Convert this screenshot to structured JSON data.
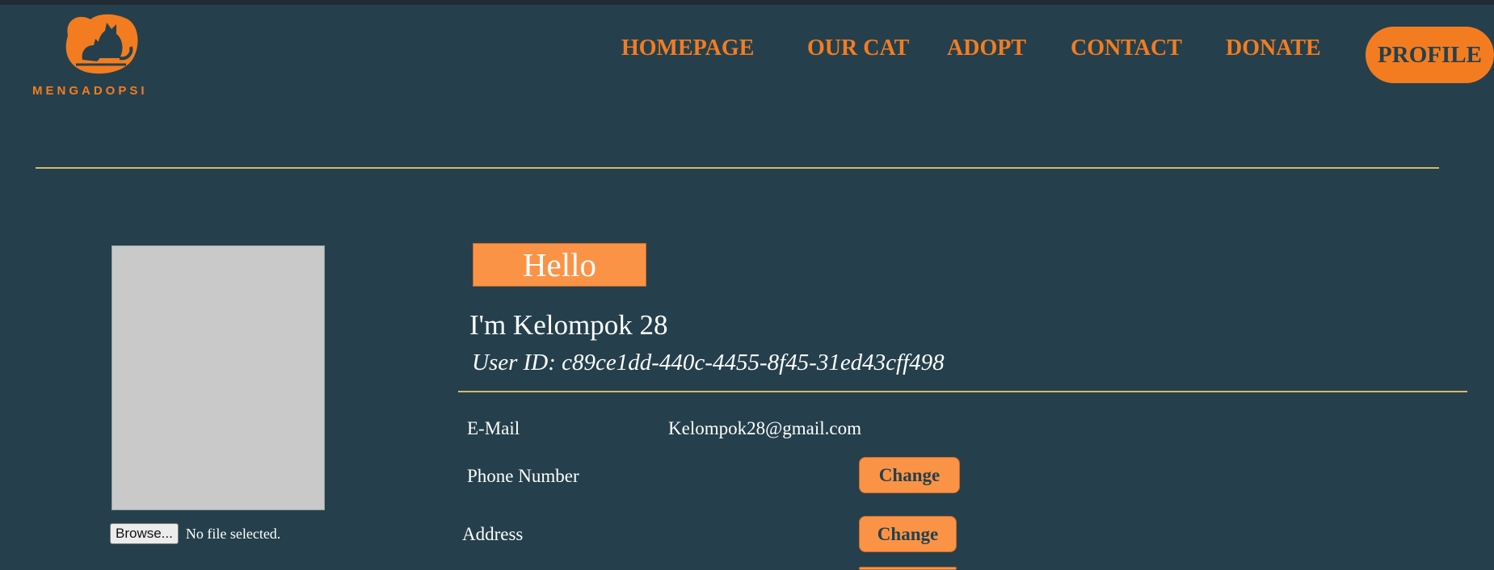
{
  "brand": {
    "name": "MENGADOPSI",
    "logo_icon": "cat-dog-logo-icon",
    "accent_color": "#f47c20"
  },
  "nav": {
    "homepage": "HOMEPAGE",
    "our_cat": "OUR CAT",
    "adopt": "ADOPT",
    "contact": "CONTACT",
    "donate": "DONATE",
    "profile": "PROFILE"
  },
  "avatar_upload": {
    "browse_label": "Browse...",
    "file_status": "No file selected."
  },
  "profile": {
    "greeting": "Hello",
    "name_line": "I'm Kelompok 28",
    "user_id_line": "User ID: c89ce1dd-440c-4455-8f45-31ed43cff498"
  },
  "fields": {
    "email_label": "E-Mail",
    "email_value": "Kelompok28@gmail.com",
    "phone_label": "Phone Number",
    "phone_change": "Change",
    "address_label": "Address",
    "address_change": "Change"
  },
  "colors": {
    "background": "#25404c",
    "button": "#fb9346",
    "divider": "#d8b86a"
  }
}
